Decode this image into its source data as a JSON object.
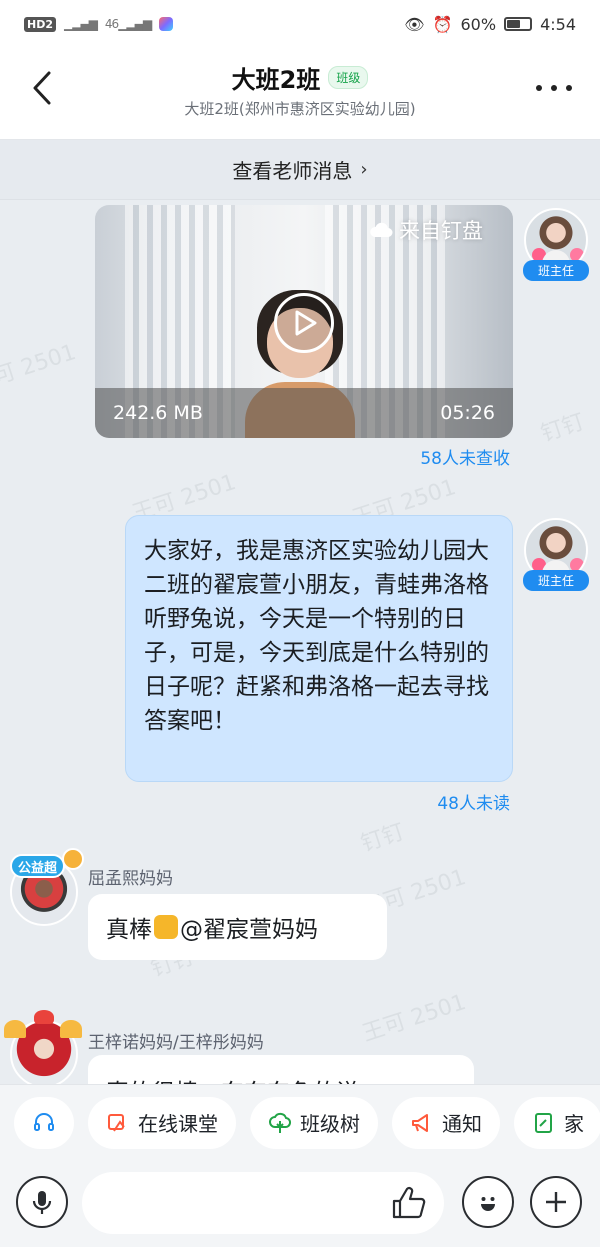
{
  "status_bar": {
    "network_label": "HD",
    "network_sub": "2",
    "signal_label": "46",
    "battery_percent": "60%",
    "battery_level": 0.6,
    "time": "4:54"
  },
  "header": {
    "title": "大班2班",
    "badge": "班级",
    "subtitle": "大班2班(郑州市惠济区实验幼儿园)"
  },
  "notice": {
    "label": "查看老师消息",
    "chevron": "›"
  },
  "watermarks": [
    "王可 2501",
    "王可 2501",
    "钉钉",
    "王可 2501",
    "钉钉",
    "王可 2501",
    "钉钉",
    "王可 2501"
  ],
  "messages": {
    "video": {
      "source_label": "来自钉盘",
      "file_size": "242.6 MB",
      "duration": "05:26",
      "read_status": "58人未查收",
      "sender_role": "班主任"
    },
    "text": {
      "content": "大家好，我是惠济区实验幼儿园大二班的翟宸萱小朋友，青蛙弗洛格听野兔说，今天是一个特别的日子，可是，今天到底是什么特别的日子呢？赶紧和弗洛格一起去寻找答案吧！",
      "read_status": "48人未读",
      "sender_role": "班主任"
    },
    "reply1": {
      "sender": "屈孟熙妈妈",
      "badge_text": "公益超",
      "text_before": "真棒",
      "mention": "@翟宸萱妈妈"
    },
    "reply2": {
      "sender": "王梓诺妈妈/王梓彤妈妈",
      "text": "真的很棒，东东东兔的说"
    }
  },
  "toolbar": {
    "items": [
      {
        "label": "",
        "icon": "headset-icon"
      },
      {
        "label": "在线课堂",
        "icon": "online-class-icon"
      },
      {
        "label": "班级树",
        "icon": "tree-icon"
      },
      {
        "label": "通知",
        "icon": "megaphone-icon"
      },
      {
        "label": "家",
        "icon": "homework-icon"
      }
    ]
  },
  "input_bar": {
    "placeholder": "",
    "icons": [
      "microphone-icon",
      "thumbs-up-icon",
      "emoji-icon",
      "plus-icon"
    ]
  },
  "colors": {
    "accent": "#1f8cf0",
    "blue_bubble": "#cfe6ff",
    "background": "#e9edf1",
    "badge_green": "#16a34a",
    "megaphone": "#ff5a3c",
    "tree": "#22a447"
  }
}
